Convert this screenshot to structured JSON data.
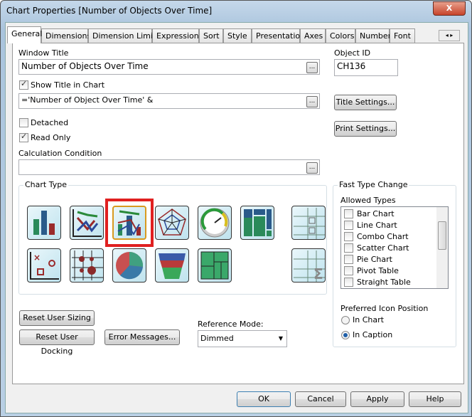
{
  "window": {
    "title": "Chart Properties [Number of Objects Over Time]",
    "close": "X"
  },
  "tabs": [
    "General",
    "Dimensions",
    "Dimension Limits",
    "Expressions",
    "Sort",
    "Style",
    "Presentation",
    "Axes",
    "Colors",
    "Number",
    "Font"
  ],
  "general": {
    "window_title_label": "Window Title",
    "window_title_value": "Number of Objects Over Time",
    "object_id_label": "Object ID",
    "object_id_value": "CH136",
    "show_title_label": "Show Title in Chart",
    "title_expr": "='Number of Object Over Time' &",
    "title_settings": "Title Settings...",
    "print_settings": "Print Settings...",
    "detached": "Detached",
    "read_only": "Read Only",
    "calc_condition_label": "Calculation Condition",
    "calc_condition_value": "",
    "ellipsis": "...",
    "chart_type_label": "Chart Type",
    "chart_types_row1": [
      "bar-chart",
      "line-chart",
      "combo-chart",
      "radar-chart",
      "gauge-chart",
      "mekko-chart",
      "pivot-table"
    ],
    "chart_types_row2": [
      "scatter-chart",
      "grid-chart",
      "pie-chart",
      "funnel-chart",
      "block-chart",
      "straight-table"
    ],
    "selected_chart_type": "combo-chart",
    "fast_type_label": "Fast Type Change",
    "allowed_types_label": "Allowed Types",
    "allowed_types": [
      "Bar Chart",
      "Line Chart",
      "Combo Chart",
      "Scatter Chart",
      "Pie Chart",
      "Pivot Table",
      "Straight Table"
    ],
    "preferred_icon_label": "Preferred Icon Position",
    "in_chart": "In Chart",
    "in_caption": "In Caption",
    "reset_sizing": "Reset User Sizing",
    "reset_docking": "Reset User Docking",
    "error_messages": "Error Messages...",
    "reference_mode_label": "Reference Mode:",
    "reference_mode_value": "Dimmed"
  },
  "footer": {
    "ok": "OK",
    "cancel": "Cancel",
    "apply": "Apply",
    "help": "Help"
  }
}
